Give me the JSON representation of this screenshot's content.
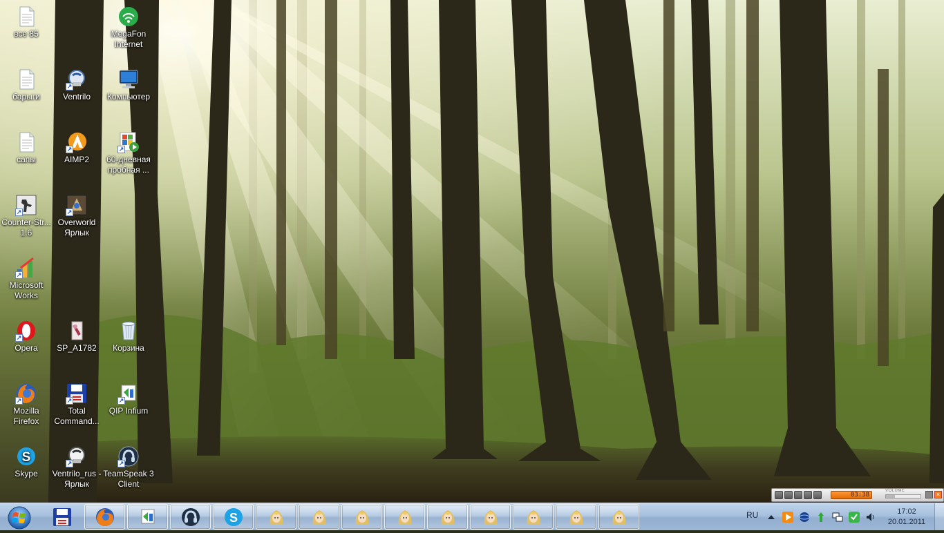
{
  "desktop": {
    "icons": [
      {
        "label": "все 85",
        "icon": "text-file-icon"
      },
      {
        "label": "барыги",
        "icon": "text-file-icon"
      },
      {
        "label": "сапы",
        "icon": "text-file-icon"
      },
      {
        "label": "Counter-Str... 1.6",
        "icon": "counter-strike-icon"
      },
      {
        "label": "Microsoft Works",
        "icon": "microsoft-works-icon"
      },
      {
        "label": "Opera",
        "icon": "opera-icon"
      },
      {
        "label": "Mozilla Firefox",
        "icon": "firefox-icon"
      },
      {
        "label": "Skype",
        "icon": "skype-icon"
      },
      {
        "label": "Ventrilo",
        "icon": "ventrilo-icon"
      },
      {
        "label": "AIMP2",
        "icon": "aimp-icon"
      },
      {
        "label": "Overworld Ярлык",
        "icon": "overworld-icon"
      },
      {
        "label": "SP_A1782",
        "icon": "image-file-icon"
      },
      {
        "label": "Total Command...",
        "icon": "total-commander-icon"
      },
      {
        "label": "Ventrilo_rus - Ярлык",
        "icon": "ventrilo-rus-icon"
      },
      {
        "label": "MegaFon Internet",
        "icon": "megafon-icon"
      },
      {
        "label": "Компьютер",
        "icon": "computer-icon"
      },
      {
        "label": "60-дневная пробная ...",
        "icon": "trial-installer-icon"
      },
      {
        "label": "Корзина",
        "icon": "recycle-bin-icon"
      },
      {
        "label": "QIP Infium",
        "icon": "qip-icon"
      },
      {
        "label": "TeamSpeak 3 Client",
        "icon": "teamspeak-icon"
      }
    ]
  },
  "taskbar": {
    "start_icon": "windows-start-orb-icon",
    "pinned": [
      {
        "name": "total-commander-taskbar-button",
        "icon": "floppy-disk-icon"
      },
      {
        "name": "firefox-taskbar-button",
        "icon": "firefox-icon"
      },
      {
        "name": "qip-taskbar-button",
        "icon": "qip-icon"
      },
      {
        "name": "teamspeak-taskbar-button",
        "icon": "teamspeak-icon"
      },
      {
        "name": "skype-taskbar-button",
        "icon": "skype-icon"
      }
    ],
    "open_windows_count": 9,
    "open_window_icon": "blonde-character-portrait-icon"
  },
  "tray": {
    "language": "RU",
    "icons": [
      "show-hidden-icons-arrow-icon",
      "aimp-tray-icon",
      "network-globe-icon",
      "qip-tray-icon",
      "network-connection-icon",
      "megafon-tray-icon",
      "volume-icon"
    ],
    "time": "17:02",
    "date": "20.01.2011"
  },
  "aimp_player": {
    "time": "03:38",
    "volume_label": "VOLUME",
    "volume_level": 0.25
  },
  "colors": {
    "taskbar": "#a7c0dd",
    "aimp_accent": "#ff8a20"
  }
}
